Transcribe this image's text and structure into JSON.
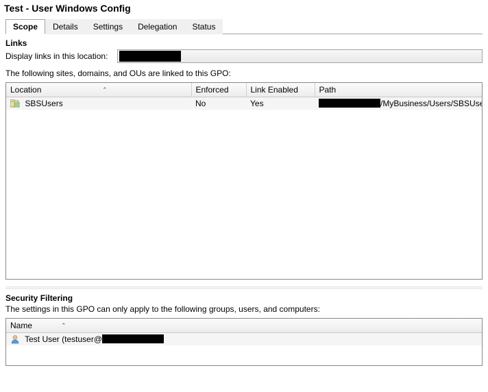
{
  "window": {
    "title": "Test - User Windows Config"
  },
  "tabs": {
    "scope": "Scope",
    "details": "Details",
    "settings": "Settings",
    "delegation": "Delegation",
    "status": "Status"
  },
  "links": {
    "header": "Links",
    "display_label": "Display links in this location:",
    "dropdown_value": ""
  },
  "linked_desc": "The following sites, domains, and OUs are linked to this GPO:",
  "link_table": {
    "headers": {
      "location": "Location",
      "enforced": "Enforced",
      "link_enabled": "Link Enabled",
      "path": "Path"
    },
    "row": {
      "location": "SBSUsers",
      "enforced": "No",
      "link_enabled": "Yes",
      "path_suffix": "/MyBusiness/Users/SBSUsers"
    }
  },
  "security": {
    "header": "Security Filtering",
    "desc": "The settings in this GPO can only apply to the following groups, users, and computers:",
    "name_header": "Name",
    "row": {
      "display_prefix": "Test User (testuser@"
    }
  }
}
